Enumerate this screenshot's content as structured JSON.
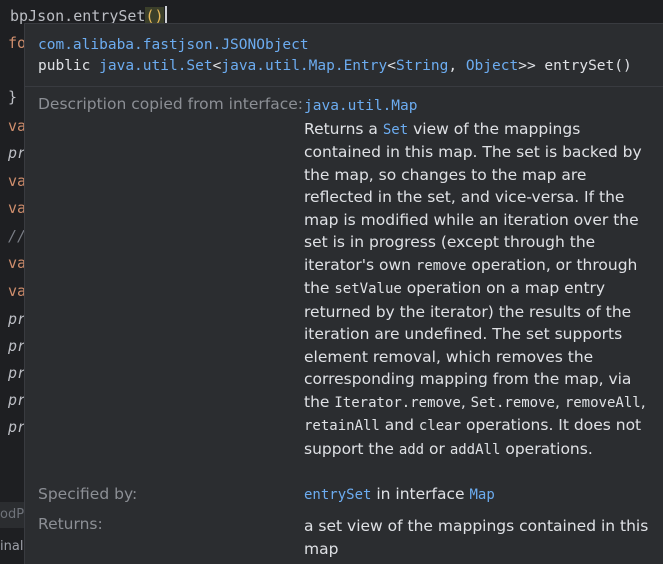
{
  "editor": {
    "line0": {
      "prefix": "bpJson.entrySet",
      "parens": "()"
    },
    "gutter_fragments": [
      {
        "text": "fo",
        "kind": "kw"
      },
      {
        "text": "}",
        "kind": "pl"
      },
      {
        "text": "va",
        "kind": "kw"
      },
      {
        "text": "pr",
        "kind": "it"
      },
      {
        "text": "va",
        "kind": "kw"
      },
      {
        "text": "va",
        "kind": "kw"
      },
      {
        "text": "//",
        "kind": "cm"
      },
      {
        "text": "va",
        "kind": "kw"
      },
      {
        "text": "va",
        "kind": "kw"
      },
      {
        "text": "pr",
        "kind": "it"
      },
      {
        "text": "pr",
        "kind": "it"
      },
      {
        "text": "pr",
        "kind": "it"
      },
      {
        "text": "pr",
        "kind": "it"
      },
      {
        "text": "pr",
        "kind": "it"
      }
    ],
    "bottom_strip_1": "odP",
    "bottom_strip_2": "inal"
  },
  "popup": {
    "class_name": "com.alibaba.fastjson.JSONObject",
    "signature": {
      "modifier": "public",
      "return_type_1": "java.util.Set",
      "lt1": "<",
      "return_type_2": "java.util.Map.Entry",
      "lt2": "<",
      "type_arg_1": "String",
      "comma": ", ",
      "type_arg_2": "Object",
      "gt": ">>",
      "method": "entrySet()"
    },
    "description": {
      "label": "Description copied from interface:",
      "source": "java.util.Map",
      "t1": "Returns a ",
      "c1": "Set",
      "t2": " view of the mappings contained in this map. The set is backed by the map, so changes to the map are reflected in the set, and vice-versa. If the map is modified while an iteration over the set is in progress (except through the iterator's own ",
      "c2": "remove",
      "t3": " operation, or through the ",
      "c3": "setValue",
      "t4": " operation on a map entry returned by the iterator) the results of the iteration are undefined. The set supports element removal, which removes the corresponding mapping from the map, via the ",
      "c4": "Iterator.remove",
      "t5": ", ",
      "c5": "Set.remove",
      "t6": ", ",
      "c6": "removeAll",
      "t7": ", ",
      "c7": "retainAll",
      "t8": " and ",
      "c8": "clear",
      "t9": " operations. It does not support the ",
      "c9": "add",
      "t10": " or ",
      "c10": "addAll",
      "t11": " operations."
    },
    "specified_by": {
      "label": "Specified by:",
      "method": "entrySet",
      "text": " in interface ",
      "interface": "Map"
    },
    "returns": {
      "label": "Returns:",
      "text": "a set view of the mappings contained in this map"
    }
  }
}
